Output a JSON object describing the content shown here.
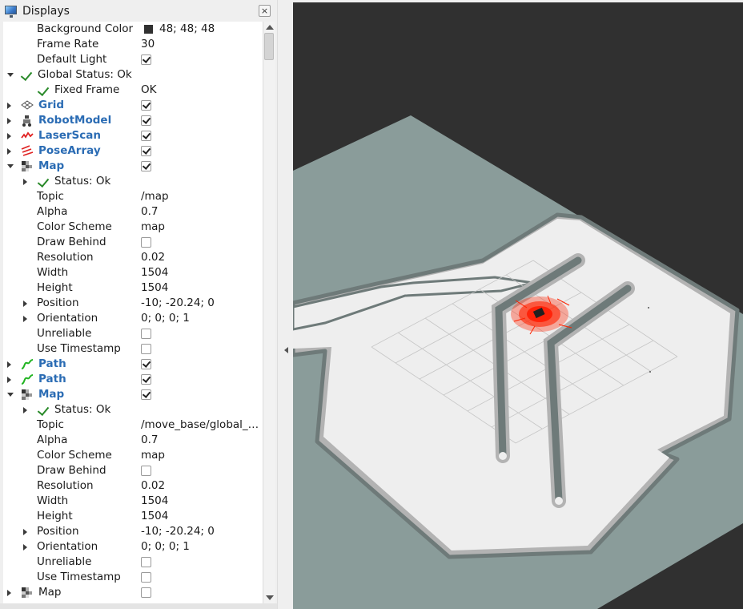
{
  "panel": {
    "title": "Displays",
    "close_glyph": "×"
  },
  "rows": [
    {
      "indent": 1,
      "label": "Background Color",
      "kind": "color",
      "value": "48; 48; 48",
      "color": "#303030"
    },
    {
      "indent": 1,
      "label": "Frame Rate",
      "kind": "text",
      "value": "30"
    },
    {
      "indent": 1,
      "label": "Default Light",
      "kind": "check",
      "checked": true
    },
    {
      "indent": 0,
      "label": "Global Status: Ok",
      "kind": "none",
      "expander": "down",
      "icon": "checkmark-icon"
    },
    {
      "indent": 2,
      "label": "Fixed Frame",
      "kind": "text",
      "value": "OK",
      "icon": "checkmark-icon"
    },
    {
      "indent": 0,
      "label": "Grid",
      "display": true,
      "kind": "check",
      "checked": true,
      "expander": "right",
      "icon": "grid-icon"
    },
    {
      "indent": 0,
      "label": "RobotModel",
      "display": true,
      "kind": "check",
      "checked": true,
      "expander": "right",
      "icon": "robot-icon"
    },
    {
      "indent": 0,
      "label": "LaserScan",
      "display": true,
      "kind": "check",
      "checked": true,
      "expander": "right",
      "icon": "laser-scan-icon"
    },
    {
      "indent": 0,
      "label": "PoseArray",
      "display": true,
      "kind": "check",
      "checked": true,
      "expander": "right",
      "icon": "pose-array-icon"
    },
    {
      "indent": 0,
      "label": "Map",
      "display": true,
      "kind": "check",
      "checked": true,
      "expander": "down",
      "icon": "map-icon"
    },
    {
      "indent": 1,
      "label": "Status: Ok",
      "kind": "none",
      "expander": "right",
      "icon": "checkmark-icon"
    },
    {
      "indent": 1,
      "label": "Topic",
      "kind": "text",
      "value": "/map"
    },
    {
      "indent": 1,
      "label": "Alpha",
      "kind": "text",
      "value": "0.7"
    },
    {
      "indent": 1,
      "label": "Color Scheme",
      "kind": "text",
      "value": "map"
    },
    {
      "indent": 1,
      "label": "Draw Behind",
      "kind": "check",
      "checked": false
    },
    {
      "indent": 1,
      "label": "Resolution",
      "kind": "text",
      "value": "0.02"
    },
    {
      "indent": 1,
      "label": "Width",
      "kind": "text",
      "value": "1504"
    },
    {
      "indent": 1,
      "label": "Height",
      "kind": "text",
      "value": "1504"
    },
    {
      "indent": 1,
      "label": "Position",
      "kind": "text",
      "value": "-10; -20.24; 0",
      "expander": "right"
    },
    {
      "indent": 1,
      "label": "Orientation",
      "kind": "text",
      "value": "0; 0; 0; 1",
      "expander": "right"
    },
    {
      "indent": 1,
      "label": "Unreliable",
      "kind": "check",
      "checked": false
    },
    {
      "indent": 1,
      "label": "Use Timestamp",
      "kind": "check",
      "checked": false
    },
    {
      "indent": 0,
      "label": "Path",
      "display": true,
      "kind": "check",
      "checked": true,
      "expander": "right",
      "icon": "path-icon"
    },
    {
      "indent": 0,
      "label": "Path",
      "display": true,
      "kind": "check",
      "checked": true,
      "expander": "right",
      "icon": "path-icon"
    },
    {
      "indent": 0,
      "label": "Map",
      "display": true,
      "kind": "check",
      "checked": true,
      "expander": "down",
      "icon": "map-icon"
    },
    {
      "indent": 1,
      "label": "Status: Ok",
      "kind": "none",
      "expander": "right",
      "icon": "checkmark-icon"
    },
    {
      "indent": 1,
      "label": "Topic",
      "kind": "text",
      "value": "/move_base/global_c..."
    },
    {
      "indent": 1,
      "label": "Alpha",
      "kind": "text",
      "value": "0.7"
    },
    {
      "indent": 1,
      "label": "Color Scheme",
      "kind": "text",
      "value": "map"
    },
    {
      "indent": 1,
      "label": "Draw Behind",
      "kind": "check",
      "checked": false
    },
    {
      "indent": 1,
      "label": "Resolution",
      "kind": "text",
      "value": "0.02"
    },
    {
      "indent": 1,
      "label": "Width",
      "kind": "text",
      "value": "1504"
    },
    {
      "indent": 1,
      "label": "Height",
      "kind": "text",
      "value": "1504"
    },
    {
      "indent": 1,
      "label": "Position",
      "kind": "text",
      "value": "-10; -20.24; 0",
      "expander": "right"
    },
    {
      "indent": 1,
      "label": "Orientation",
      "kind": "text",
      "value": "0; 0; 0; 1",
      "expander": "right"
    },
    {
      "indent": 1,
      "label": "Unreliable",
      "kind": "check",
      "checked": false
    },
    {
      "indent": 1,
      "label": "Use Timestamp",
      "kind": "check",
      "checked": false
    },
    {
      "indent": 0,
      "label": "Map",
      "display": false,
      "kind": "check",
      "checked": false,
      "expander": "right",
      "icon": "map-icon"
    }
  ],
  "colors": {
    "display_name": "#2b6cb4",
    "status_ok": "#2a8a2a",
    "viewport_bg": "#303030",
    "map_unknown": "#8a9c9a",
    "map_free": "#eeeeee",
    "map_wall": "#6e7a79",
    "map_inflation": "#b3b3b3",
    "laser": "#ff2200"
  }
}
